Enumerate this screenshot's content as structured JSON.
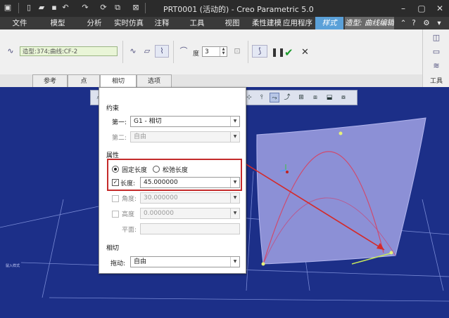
{
  "window": {
    "title": "PRT0001 (活动的) - Creo Parametric 5.0"
  },
  "ribbon_tabs": [
    "文件",
    "模型",
    "分析",
    "实时仿真",
    "注释",
    "工具",
    "视图",
    "柔性建模",
    "应用程序",
    "样式",
    "造型: 曲线编辑"
  ],
  "ribbon": {
    "entity_field": "造型:374;曲线:CF-2",
    "degree_label": "度",
    "degree_value": "3"
  },
  "sub_tabs": [
    "参考",
    "点",
    "相切",
    "选项"
  ],
  "right_panel": {
    "tools_label": "工具"
  },
  "panel": {
    "constraint_header": "约束",
    "first_label": "第一:",
    "first_value": "G1 - 相切",
    "second_label": "第二:",
    "second_value": "自由",
    "properties_header": "属性",
    "fixed_length_label": "固定长度",
    "free_length_label": "松弛长度",
    "length_label": "长度:",
    "length_value": "45.000000",
    "angle_label": "角度:",
    "angle_value": "30.000000",
    "height_label": "高度",
    "height_value": "0.000000",
    "plane_label": "平面:",
    "tangent_header": "相切",
    "drag_label": "拖动:",
    "drag_value": "自由"
  },
  "viewport": {
    "side_label": "鼠入样式"
  },
  "colors": {
    "viewport_bg": "#1c2f88",
    "surface": "#8f92d6",
    "curve": "#d0496c",
    "arrow": "#d42a2a",
    "highlight_box": "#c42b2b",
    "accent_tab": "#5aa0d8"
  }
}
